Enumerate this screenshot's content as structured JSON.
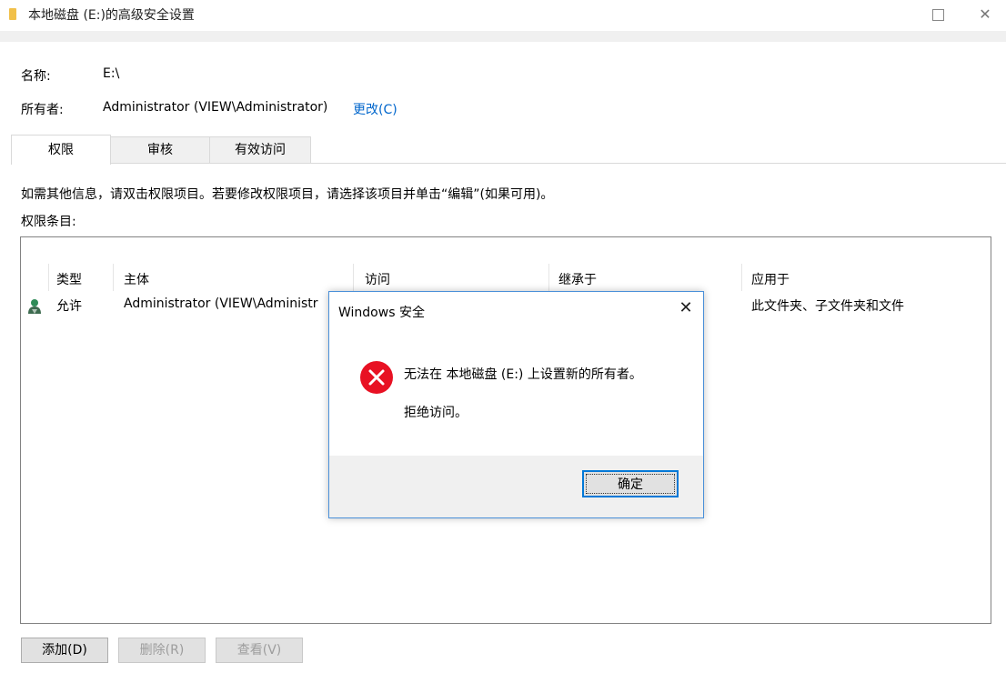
{
  "window": {
    "title": "本地磁盘 (E:)的高级安全设置",
    "folder_icon": "folder-icon",
    "maximize_icon": "maximize-icon",
    "close_icon": "close-icon"
  },
  "info": {
    "name_label": "名称:",
    "name_value": "E:\\",
    "owner_label": "所有者:",
    "owner_value": "Administrator (VIEW\\Administrator)",
    "change_link": "更改(C)"
  },
  "tabs": [
    {
      "label": "权限",
      "active": true
    },
    {
      "label": "审核",
      "active": false
    },
    {
      "label": "有效访问",
      "active": false
    }
  ],
  "instructions": "如需其他信息，请双击权限项目。若要修改权限项目，请选择该项目并单击“编辑”(如果可用)。",
  "entries_label": "权限条目:",
  "table": {
    "columns": [
      "类型",
      "主体",
      "访问",
      "继承于",
      "应用于"
    ],
    "rows": [
      {
        "icon": "user-icon",
        "type": "允许",
        "principal": "Administrator (VIEW\\Administr",
        "access": "",
        "inherited": "",
        "applies": "此文件夹、子文件夹和文件"
      }
    ]
  },
  "buttons": {
    "add": "添加(D)",
    "remove": "删除(R)",
    "view": "查看(V)"
  },
  "dialog": {
    "title": "Windows 安全",
    "icon": "error-icon",
    "message": "无法在 本地磁盘 (E:) 上设置新的所有者。",
    "detail": "拒绝访问。",
    "ok": "确定",
    "close_icon": "close-icon"
  },
  "colors": {
    "accent": "#0078d7",
    "link": "#0066cc",
    "error": "#e81123"
  }
}
